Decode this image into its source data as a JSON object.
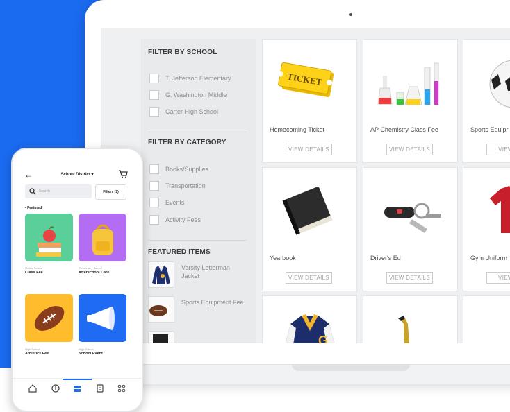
{
  "filters": {
    "school_heading": "FILTER BY SCHOOL",
    "schools": [
      "T. Jefferson Elementary",
      "G. Washington Middle",
      "Carter High School"
    ],
    "category_heading": "FILTER BY CATEGORY",
    "categories": [
      "Books/Supplies",
      "Transportation",
      "Events",
      "Activity Fees"
    ],
    "featured_heading": "FEATURED ITEMS",
    "featured": [
      "Varsity Letterman Jacket",
      "Sports Equipment Fee"
    ]
  },
  "products": [
    {
      "title": "Homecoming Ticket",
      "button": "VIEW DETAILS",
      "ticket_text": "TICKET"
    },
    {
      "title": "AP Chemistry Class Fee",
      "button": "VIEW DETAILS"
    },
    {
      "title": "Sports Equipr",
      "button": "VIEW DI"
    },
    {
      "title": "Yearbook",
      "button": "VIEW DETAILS"
    },
    {
      "title": "Driver's Ed",
      "button": "VIEW DETAILS"
    },
    {
      "title": "Gym Uniform",
      "button": "VIEW DI"
    }
  ],
  "phone": {
    "title": "School District ▾",
    "search_placeholder": "Search",
    "filter_button": "Filters (1)",
    "featured_label": "• Featured",
    "tiles": [
      {
        "sub": "Middle School",
        "name": "Class Fee",
        "color": "#5bcf9a"
      },
      {
        "sub": "Elementary School",
        "name": "Afterschool Care",
        "color": "#b36df2"
      },
      {
        "sub": "High School",
        "name": "Athletics Fee",
        "color": "#ffbd2e"
      },
      {
        "sub": "High School",
        "name": "School Event",
        "color": "#1f6bf3"
      }
    ],
    "tabs": [
      "home-icon",
      "money-icon",
      "store-icon",
      "document-icon",
      "grid-icon"
    ]
  },
  "colors": {
    "brand_blue": "#1a6bf0"
  }
}
